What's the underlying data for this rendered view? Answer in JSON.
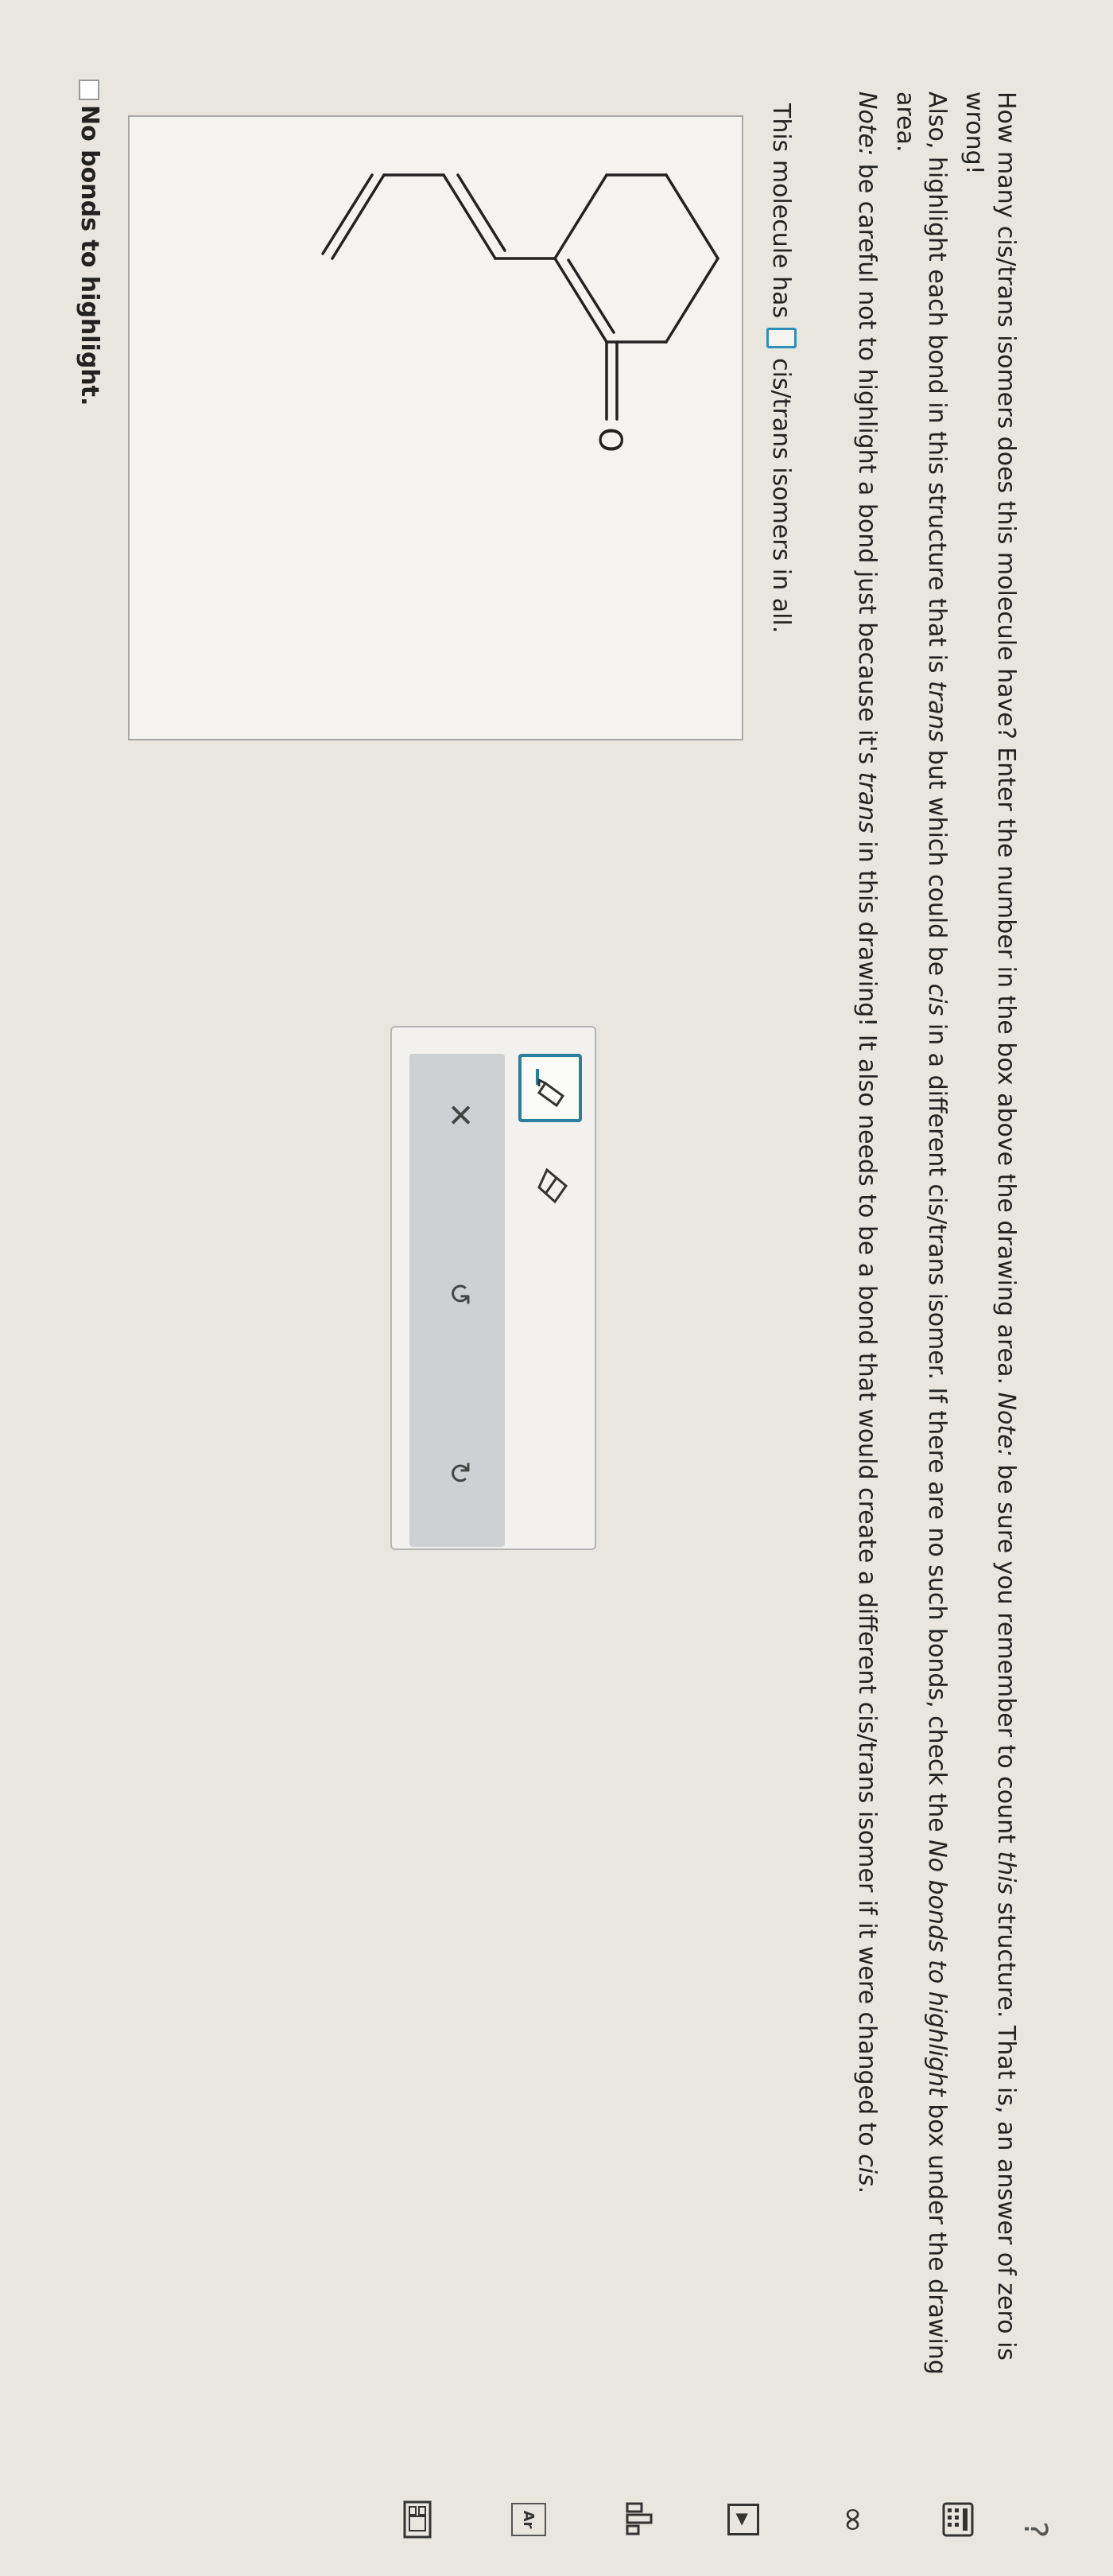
{
  "question": {
    "p1_a": "How many cis/trans isomers does this molecule have? Enter the number in the box above the drawing area. ",
    "p1_note": "Note:",
    "p1_b": " be sure you remember to count ",
    "p1_this": "this",
    "p1_c": " structure. That is, an answer of zero is wrong!",
    "p2_a": "Also, highlight each bond in this structure that is ",
    "p2_trans": "trans",
    "p2_b": " but which could be ",
    "p2_cis": "cis",
    "p2_c": " in a different cis/trans isomer. If there are no such bonds, check the ",
    "p2_nobonds": "No bonds to highlight",
    "p2_d": " box under the drawing area.",
    "p3_note": "Note:",
    "p3_a": " be careful not to highlight a bond just because it's ",
    "p3_trans": "trans",
    "p3_b": " in this drawing! It also needs to be a bond that would create a different cis/trans isomer if it were changed to ",
    "p3_cis": "cis",
    "p3_c": "."
  },
  "answer_sentence": {
    "before": "This molecule has",
    "after": "cis/trans isomers in all.",
    "value": ""
  },
  "molecule": {
    "oxygen_label": "O"
  },
  "no_bonds": {
    "label": "No bonds to highlight.",
    "checked": false
  },
  "toolbar": {
    "clear_glyph": "✕",
    "undo_glyph": "↺",
    "redo_glyph": "↻"
  },
  "sidebar": {
    "help_glyph": "?",
    "infinity_glyph": "∞",
    "play_glyph": "▶",
    "ar_label": "Ar"
  },
  "colors": {
    "accent": "#2a7f9e",
    "answer_box": "#2f8fb8",
    "background": "#e9e6e0"
  }
}
